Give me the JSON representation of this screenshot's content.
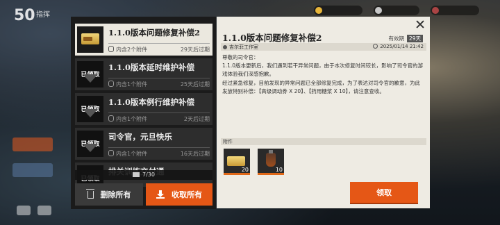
{
  "hud": {
    "level": "50",
    "player_name": "指挥"
  },
  "mail_list": {
    "items": [
      {
        "title": "1.1.0版本问题修复补偿2",
        "attachments": "内含2个附件",
        "expires": "29天后过期",
        "claimed": false,
        "active": true
      },
      {
        "title": "1.1.0版本延时维护补偿",
        "attachments": "内含1个附件",
        "expires": "25天后过期",
        "claimed": true,
        "claimed_label": "已领取"
      },
      {
        "title": "1.1.0版本例行维护补偿",
        "attachments": "内含1个附件",
        "expires": "2天后过期",
        "claimed": true,
        "claimed_label": "已领取"
      },
      {
        "title": "司令官，元旦快乐",
        "attachments": "内含1个附件",
        "expires": "16天后过期",
        "claimed": true,
        "claimed_label": "已领取"
      },
      {
        "title": "排关训练交付通",
        "attachments": "",
        "expires": "",
        "claimed": true,
        "claimed_label": "已领取"
      }
    ],
    "count": "7/30",
    "delete_all": "删除所有",
    "collect_all": "收取所有"
  },
  "detail": {
    "title": "1.1.0版本问题修复补偿2",
    "validity_label": "有效期",
    "validity_days": "29天",
    "sender": "吉尔菲工作室",
    "date": "2025/01/14 21:42",
    "body": [
      "尊敬的司令官：",
      "1.1.0版本更新后，我们遇到若干异常问题，由于本次修复时间较长，影响了司令官的游戏体验我们深感抱歉。",
      "经过紧急修复，目前发现的异常问题已全部修复完成，为了表达对司令官的歉意，为此发放特别补偿：【高级调动券 X 20】、【药用糖浆 X 10】，请注意查收。"
    ],
    "attachments_label": "附件",
    "attachments": [
      {
        "icon": "ticket-icon",
        "qty": "20"
      },
      {
        "icon": "syrup-bottle-icon",
        "qty": "10"
      }
    ],
    "claim_button": "领取"
  },
  "colors": {
    "accent": "#e55716",
    "panel_dark": "#1b1b1b",
    "panel_light": "#eeebe3"
  }
}
